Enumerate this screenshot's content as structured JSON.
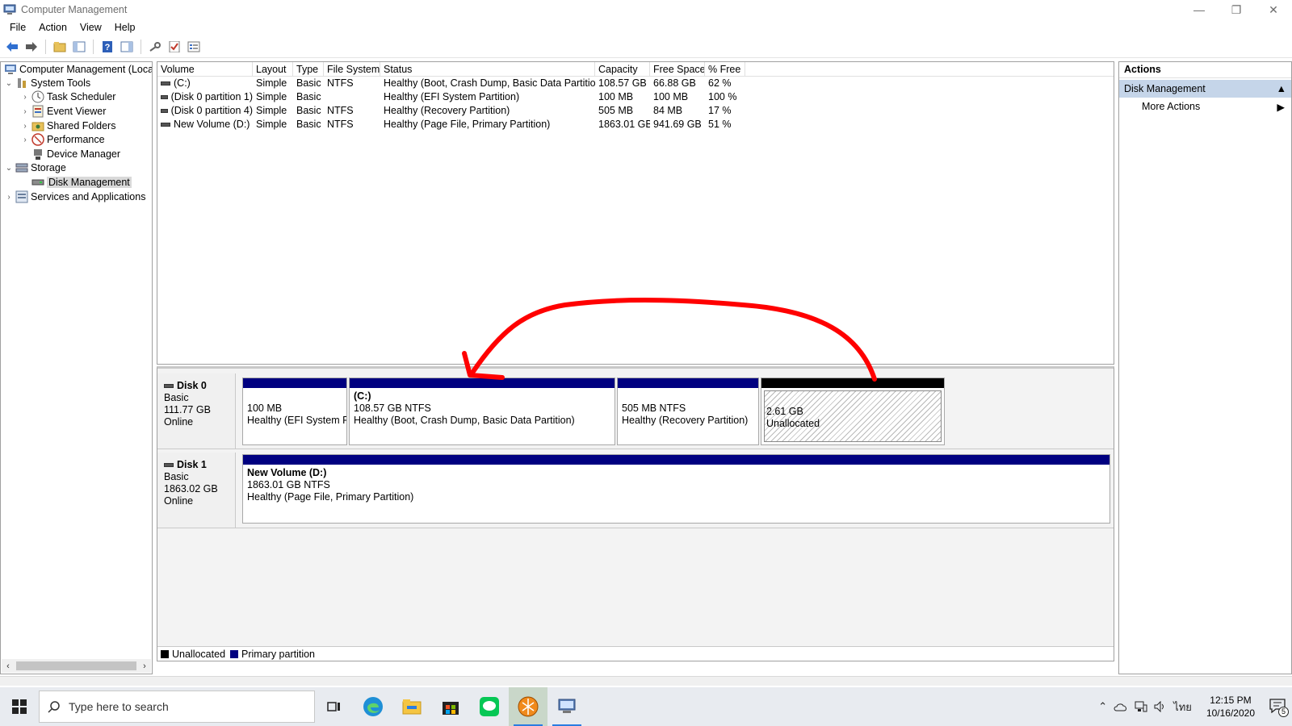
{
  "window": {
    "title": "Computer Management",
    "minimize": "—",
    "restore": "❐",
    "close": "✕"
  },
  "menu": [
    "File",
    "Action",
    "View",
    "Help"
  ],
  "tree": {
    "root": "Computer Management (Local",
    "system_tools": "System Tools",
    "task_scheduler": "Task Scheduler",
    "event_viewer": "Event Viewer",
    "shared_folders": "Shared Folders",
    "performance": "Performance",
    "device_manager": "Device Manager",
    "storage": "Storage",
    "disk_management": "Disk Management",
    "services": "Services and Applications"
  },
  "volume_table": {
    "headers": [
      "Volume",
      "Layout",
      "Type",
      "File System",
      "Status",
      "Capacity",
      "Free Space",
      "% Free"
    ],
    "rows": [
      {
        "volume": "(C:)",
        "layout": "Simple",
        "type": "Basic",
        "fs": "NTFS",
        "status": "Healthy (Boot, Crash Dump, Basic Data Partition)",
        "capacity": "108.57 GB",
        "free": "66.88 GB",
        "pct": "62 %"
      },
      {
        "volume": "(Disk 0 partition 1)",
        "layout": "Simple",
        "type": "Basic",
        "fs": "",
        "status": "Healthy (EFI System Partition)",
        "capacity": "100 MB",
        "free": "100 MB",
        "pct": "100 %"
      },
      {
        "volume": "(Disk 0 partition 4)",
        "layout": "Simple",
        "type": "Basic",
        "fs": "NTFS",
        "status": "Healthy (Recovery Partition)",
        "capacity": "505 MB",
        "free": "84 MB",
        "pct": "17 %"
      },
      {
        "volume": "New Volume (D:)",
        "layout": "Simple",
        "type": "Basic",
        "fs": "NTFS",
        "status": "Healthy (Page File, Primary Partition)",
        "capacity": "1863.01 GB",
        "free": "941.69 GB",
        "pct": "51 %"
      }
    ]
  },
  "disks": {
    "disk0": {
      "name": "Disk 0",
      "type": "Basic",
      "size": "111.77 GB",
      "state": "Online",
      "parts": {
        "efi": {
          "line1": "100 MB",
          "line2": "Healthy (EFI System Pa"
        },
        "c": {
          "title": "(C:)",
          "line1": "108.57 GB NTFS",
          "line2": "Healthy (Boot, Crash Dump, Basic Data Partition)"
        },
        "recovery": {
          "line1": "505 MB NTFS",
          "line2": "Healthy (Recovery Partition)"
        },
        "unalloc": {
          "line1": "2.61 GB",
          "line2": "Unallocated"
        }
      }
    },
    "disk1": {
      "name": "Disk 1",
      "type": "Basic",
      "size": "1863.02 GB",
      "state": "Online",
      "parts": {
        "d": {
          "title": "New Volume  (D:)",
          "line1": "1863.01 GB NTFS",
          "line2": "Healthy (Page File, Primary Partition)"
        }
      }
    }
  },
  "legend": {
    "unallocated": "Unallocated",
    "primary": "Primary partition"
  },
  "actions": {
    "header": "Actions",
    "group": "Disk Management",
    "more": "More Actions"
  },
  "taskbar": {
    "search_placeholder": "Type here to search",
    "time": "12:15 PM",
    "date": "10/16/2020",
    "lang": "ไทย",
    "notif_count": "5"
  },
  "colors": {
    "primary_partition": "#000080",
    "unallocated": "#000000",
    "annotation": "#ff0000",
    "selection": "#c5d5e9"
  }
}
